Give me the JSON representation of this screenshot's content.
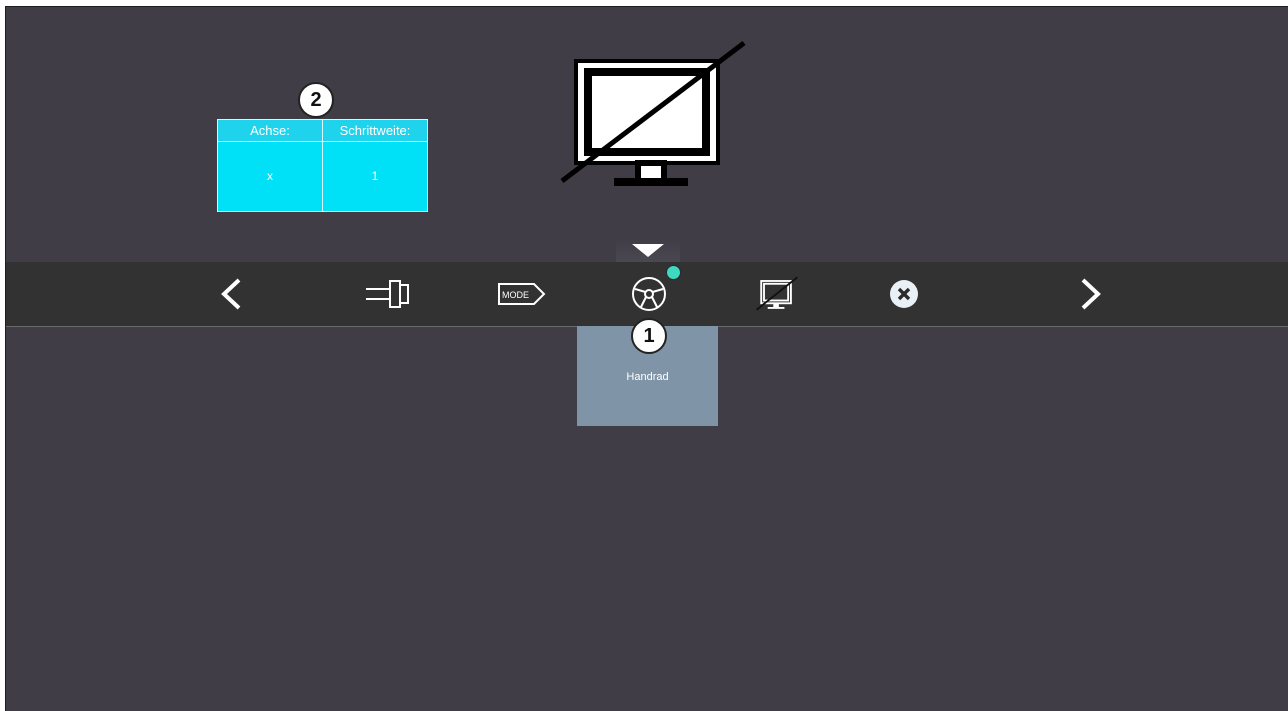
{
  "table": {
    "headers": [
      "Achse:",
      "Schrittweite:"
    ],
    "values": [
      "x",
      "1"
    ]
  },
  "badges": {
    "one": "1",
    "two": "2"
  },
  "toolbar": {
    "items": [
      {
        "icon": "chevron-left-icon"
      },
      {
        "icon": "cylinder-icon"
      },
      {
        "icon": "mode-icon",
        "label": "MODE"
      },
      {
        "icon": "handwheel-icon",
        "selected": true
      },
      {
        "icon": "no-display-icon"
      },
      {
        "icon": "close-circle-icon"
      },
      {
        "icon": "chevron-right-icon"
      }
    ]
  },
  "submenu": {
    "handrad_label": "Handrad"
  },
  "colors": {
    "background": "#403d47",
    "toolbar": "#323233",
    "table": "#00e0f7",
    "card": "#8094a7",
    "check": "#3dd9c2"
  }
}
